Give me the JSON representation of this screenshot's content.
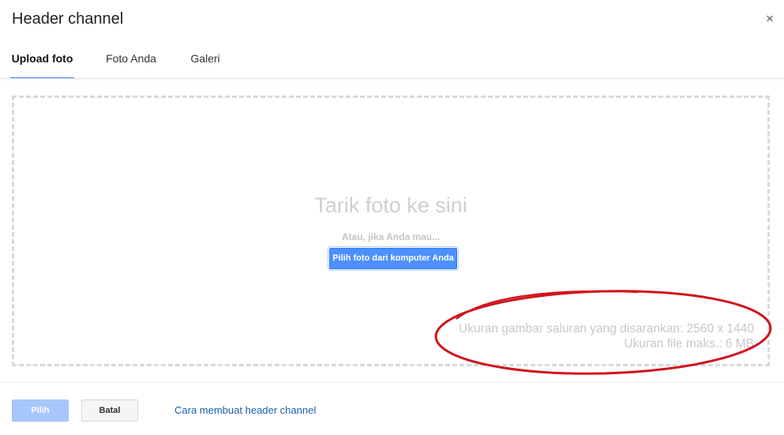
{
  "dialog": {
    "title": "Header channel",
    "close_symbol": "×",
    "close_icon": "close-icon"
  },
  "tabs": [
    {
      "label": "Upload foto",
      "active": true
    },
    {
      "label": "Foto Anda",
      "active": false
    },
    {
      "label": "Galeri",
      "active": false
    }
  ],
  "drop_zone": {
    "title": "Tarik foto ke sini",
    "or_text": "Atau, jika Anda mau...",
    "choose_button_label": "Pilih foto dari komputer Anda",
    "recommended_size": "Ukuran gambar saluran yang disarankan: 2560 x 1440",
    "max_file_size": "Ukuran file maks.: 6 MB"
  },
  "footer": {
    "select_label": "Pilih",
    "cancel_label": "Batal",
    "help_link": "Cara membuat header channel"
  },
  "colors": {
    "accent": "#4285f4",
    "primary_button": "#4d90fe",
    "primary_button_disabled": "#a7c7fc",
    "link": "#1a5fb4",
    "annotation_ellipse": "#d0141c"
  }
}
